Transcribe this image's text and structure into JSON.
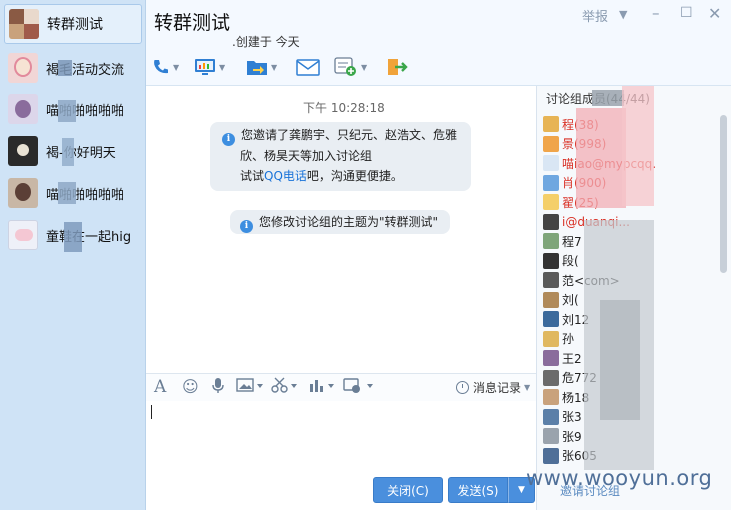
{
  "conversations": [
    {
      "name": "转群测试",
      "active": true
    },
    {
      "name": "褐毛活动交流",
      "active": false
    },
    {
      "name": "喵啪啪啪啪啪",
      "active": false
    },
    {
      "name": "褐-你好明天",
      "active": false
    },
    {
      "name": "喵啪啪啪啪啪",
      "active": false
    },
    {
      "name": "童鞋在一起hig",
      "active": false
    }
  ],
  "header": {
    "title": "转群测试",
    "subtitle": ".创建于 今天",
    "report_label": "举报"
  },
  "messages": {
    "time": "下午 10:28:18",
    "invite_line1": "您邀请了龚鹏宇、只纪元、赵浩文、危雅",
    "invite_line2": "欣、杨昊天等加入讨论组",
    "invite_line3_pre": "试试",
    "invite_link": "QQ电话",
    "invite_line3_post": "吧，沟通更便捷。",
    "rename_notice": "您修改讨论组的主题为\"转群测试\""
  },
  "editor": {
    "history_label": "消息记录"
  },
  "buttons": {
    "close": "关闭(C)",
    "send": "发送(S)"
  },
  "members": {
    "title": "讨论组成员(44/44)",
    "list": [
      {
        "name": "程(38)",
        "red": true
      },
      {
        "name": "景(998)",
        "red": true
      },
      {
        "name": "喵iao@mypcqq.",
        "red": true
      },
      {
        "name": "肖(900)",
        "red": true
      },
      {
        "name": "翟(25)",
        "red": true
      },
      {
        "name": "i@duanqi...",
        "red": true
      },
      {
        "name": "程7",
        "red": false
      },
      {
        "name": "段(",
        "red": false
      },
      {
        "name": "范<com>",
        "red": false
      },
      {
        "name": "刘(",
        "red": false
      },
      {
        "name": "刘12",
        "red": false
      },
      {
        "name": "孙",
        "red": false
      },
      {
        "name": "王2",
        "red": false
      },
      {
        "name": "危772",
        "red": false
      },
      {
        "name": "杨18",
        "red": false
      },
      {
        "name": "张3",
        "red": false
      },
      {
        "name": "张9",
        "red": false
      },
      {
        "name": "张605",
        "red": false
      }
    ],
    "add_label": "邀请讨论组"
  },
  "watermark": "www.wooyun.org",
  "colors": {
    "accent": "#4a8fdd",
    "sidebar_bg": "#cfe3f6",
    "member_red": "#d93025",
    "link": "#1a73d9"
  }
}
